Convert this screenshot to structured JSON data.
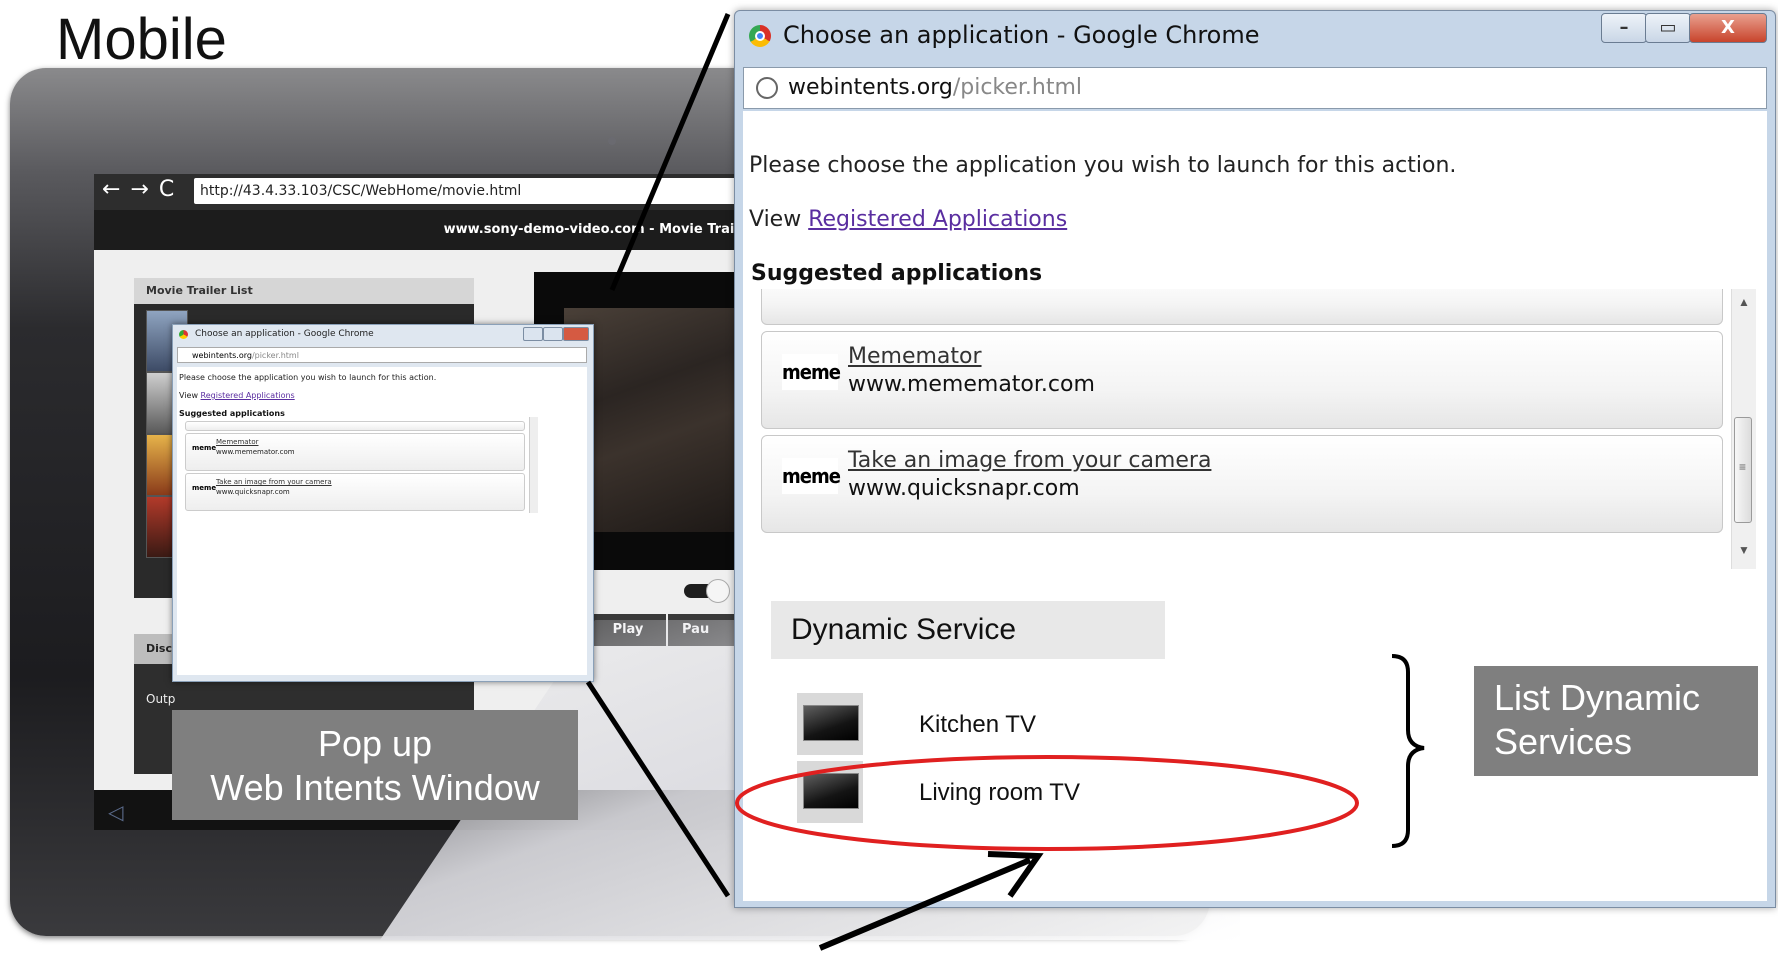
{
  "labels": {
    "mobile": "Mobile",
    "popup_line1": "Pop up",
    "popup_line2": "Web Intents Window",
    "list_dynamic_line1": "List Dynamic",
    "list_dynamic_line2": "Services"
  },
  "tablet": {
    "url": "http://43.4.33.103/CSC/WebHome/movie.html",
    "site_title": "www.sony-demo-video.com - Movie Trailer",
    "movie_list_title": "Movie Trailer List",
    "discovery_title": "Disco",
    "output_label": "Outp",
    "play_label": "Play",
    "pause_label": "Pau"
  },
  "window": {
    "title": "Choose an application - Google Chrome",
    "address_host": "webintents.org",
    "address_path": "/picker.html",
    "instruction": "Please choose the application you wish to launch for this action.",
    "view_prefix": "View ",
    "view_link": "Registered Applications",
    "suggested_title": "Suggested applications",
    "apps": [
      {
        "logo": "meme",
        "name": "Mememator",
        "url": "www.mememator.com"
      },
      {
        "logo": "meme",
        "name": "Take an image from your camera",
        "url": "www.quicksnapr.com"
      }
    ],
    "dynamic_service_title": "Dynamic Service",
    "dynamic_services": [
      "Kitchen TV",
      "Living room TV"
    ]
  },
  "colors": {
    "highlight_ellipse": "#e02020",
    "label_bg": "#7f7f7f",
    "link": "#5a2ea0"
  }
}
